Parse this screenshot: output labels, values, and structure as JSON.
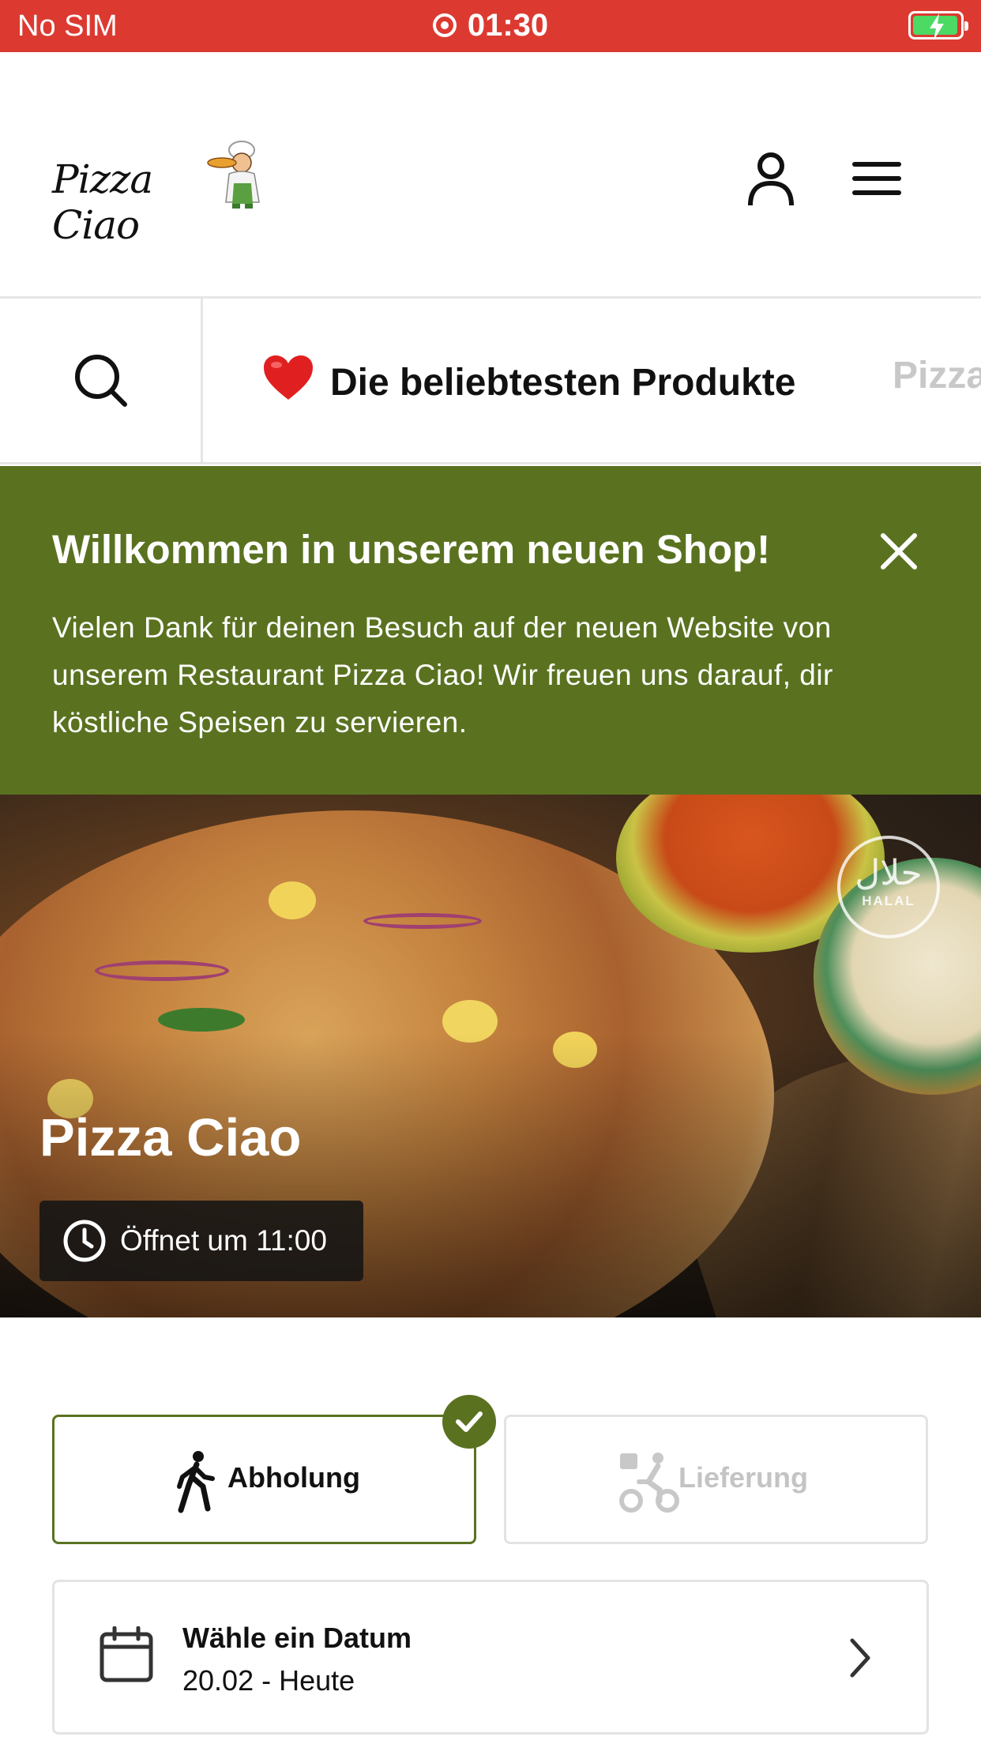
{
  "status_bar": {
    "carrier": "No SIM",
    "time": "01:30"
  },
  "header": {
    "logo_text": "Pizza Ciao"
  },
  "category_nav": {
    "items": [
      {
        "label": "Die beliebtesten Produkte",
        "icon": "heart-icon",
        "active": true
      },
      {
        "label": "Pizza",
        "active": false
      }
    ]
  },
  "welcome_banner": {
    "title": "Willkommen in unserem neuen Shop!",
    "body": "Vielen Dank für deinen Besuch auf der neuen Website von unserem Restaurant Pizza Ciao! Wir freuen uns darauf, dir köstliche Speisen zu servieren.",
    "color": "#5a7220"
  },
  "hero": {
    "restaurant_name": "Pizza Ciao",
    "opening_status": "Öffnet um 11:00",
    "badge": {
      "arabic": "حلال",
      "label": "HALAL"
    }
  },
  "order_mode": {
    "options": [
      {
        "label": "Abholung",
        "icon": "walking-person-icon",
        "selected": true
      },
      {
        "label": "Lieferung",
        "icon": "bicycle-delivery-icon",
        "selected": false
      }
    ]
  },
  "date_picker": {
    "label": "Wähle ein Datum",
    "value": "20.02 - Heute"
  },
  "colors": {
    "status_bar": "#dc3a31",
    "accent": "#5a7220"
  }
}
